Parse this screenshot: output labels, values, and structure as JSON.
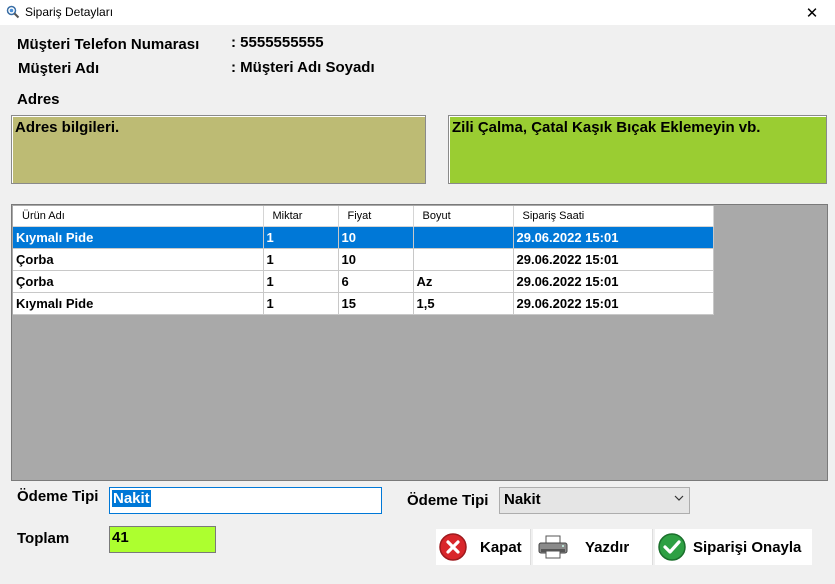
{
  "window": {
    "title": "Sipariş Detayları",
    "close_glyph": "✕"
  },
  "customer": {
    "phone_label": "Müşteri Telefon Numarası",
    "phone_value": ": 5555555555",
    "name_label": "Müşteri Adı",
    "name_value": ": Müşteri Adı Soyadı",
    "address_label": "Adres",
    "address_text": "Adres bilgileri.",
    "note_text": "Zili Çalma, Çatal Kaşık Bıçak Eklemeyin vb."
  },
  "colors": {
    "address_bg": "#bdbb74",
    "note_bg": "#9acd32",
    "total_bg": "#adff2f",
    "selection": "#0078d7"
  },
  "order_table": {
    "columns": [
      "Ürün Adı",
      "Miktar",
      "Fiyat",
      "Boyut",
      "Sipariş Saati"
    ],
    "rows": [
      [
        "Kıymalı Pide",
        "1",
        "10",
        "",
        "29.06.2022 15:01"
      ],
      [
        "Çorba",
        "1",
        "10",
        "",
        "29.06.2022 15:01"
      ],
      [
        "Çorba",
        "1",
        "6",
        "Az",
        "29.06.2022 15:01"
      ],
      [
        "Kıymalı Pide",
        "1",
        "15",
        "1,5",
        "29.06.2022 15:01"
      ]
    ],
    "selected_row": 0
  },
  "payment": {
    "label": "Ödeme Tipi",
    "input_value": "Nakit",
    "combo_label": "Ödeme Tipi",
    "combo_value": "Nakit"
  },
  "total": {
    "label": "Toplam",
    "value": "41"
  },
  "buttons": {
    "close": "Kapat",
    "print": "Yazdır",
    "confirm": "Siparişi Onayla"
  },
  "icons": {
    "app": "search-globe-icon",
    "close_button": "red-x-circle-icon",
    "print_button": "printer-icon",
    "confirm_button": "green-check-circle-icon",
    "combo": "chevron-down-icon"
  }
}
